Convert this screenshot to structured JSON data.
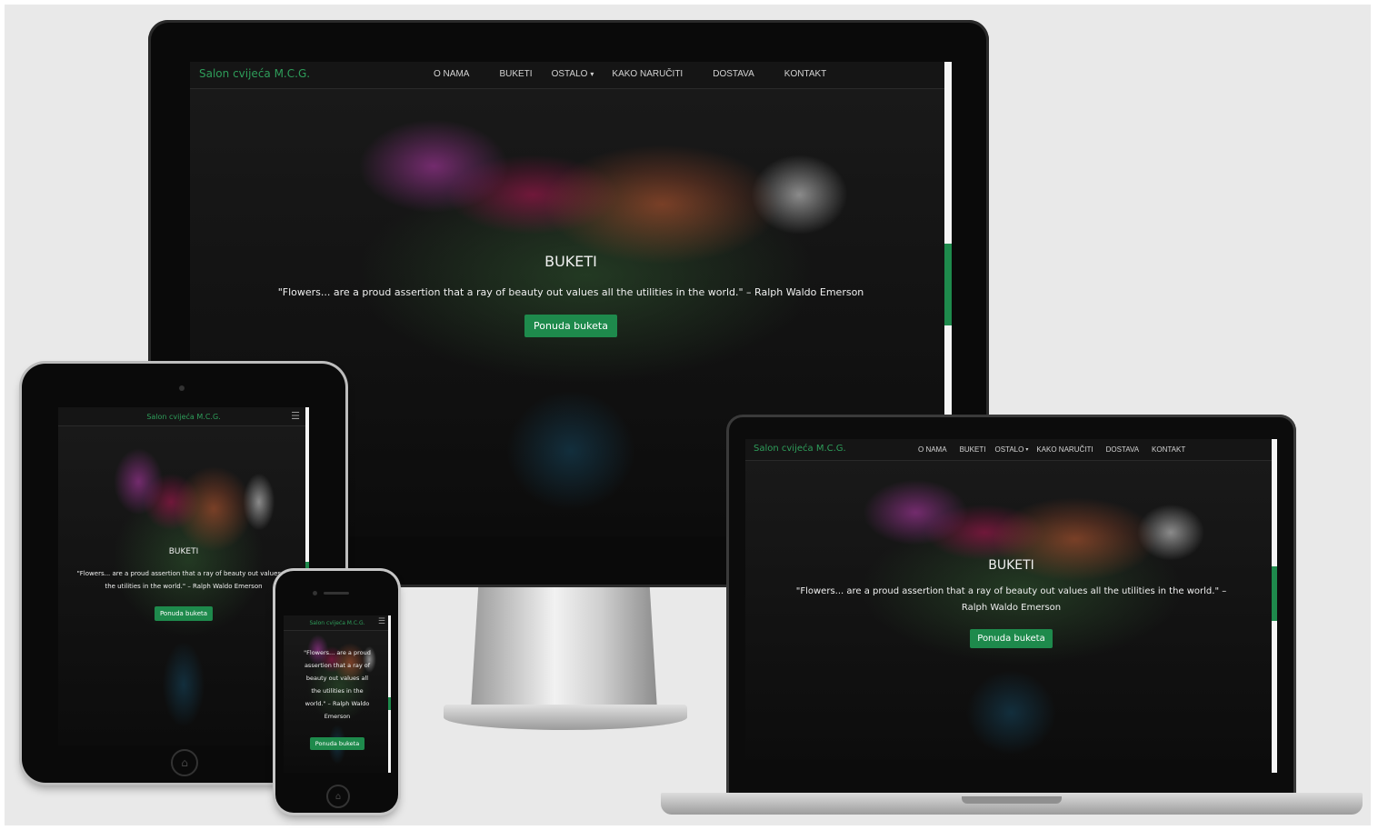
{
  "site": {
    "brand": "Salon cvijeća M.C.G.",
    "nav_items": [
      "O NAMA",
      "BUKETI",
      "OSTALO",
      "KAKO NARUČITI",
      "DOSTAVA",
      "KONTAKT"
    ],
    "dropdown_caret": "▾",
    "hamburger_icon": "☰",
    "hero": {
      "title": "BUKETI",
      "quote": "\"Flowers... are a proud assertion that a ray of beauty out values all the utilities in the world.\" – Ralph Waldo Emerson",
      "quote_phone": "\"Flowers... are a proud assertion that a ray of beauty out values all the utilities in the world.\" – Ralph Waldo Emerson",
      "cta_label": "Ponuda buketa"
    }
  },
  "colors": {
    "accent": "#1e8a4c",
    "brand": "#2e9d5a",
    "background": "#e9e9e9"
  },
  "device_icons": {
    "home_button": "home-button-icon"
  }
}
